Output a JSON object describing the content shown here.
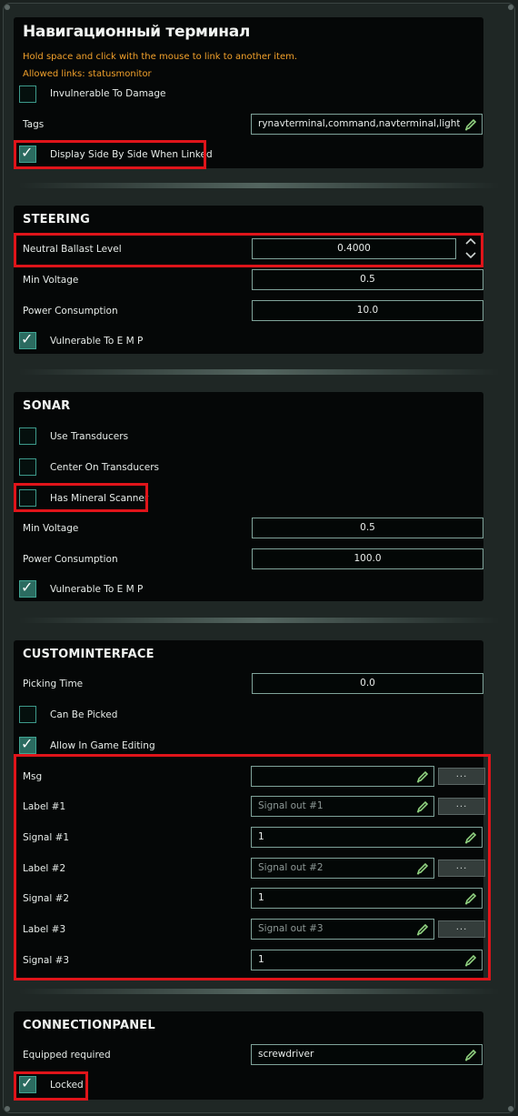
{
  "window": {
    "title": "Навигационный терминал",
    "hint": "Hold space and click with the mouse to link to another item.",
    "allowed_links": "Allowed links: statusmonitor"
  },
  "general": {
    "invulnerable_label": "Invulnerable To Damage",
    "invulnerable_checked": false,
    "tags_label": "Tags",
    "tags_value": "rynavterminal,command,navterminal,light",
    "side_by_side_label": "Display Side By Side When Linked",
    "side_by_side_checked": true
  },
  "steering": {
    "title": "STEERING",
    "ballast_label": "Neutral Ballast Level",
    "ballast_value": "0.4000",
    "min_voltage_label": "Min Voltage",
    "min_voltage_value": "0.5",
    "power_label": "Power Consumption",
    "power_value": "10.0",
    "emp_label": "Vulnerable To E M P",
    "emp_checked": true
  },
  "sonar": {
    "title": "SONAR",
    "use_transducers_label": "Use Transducers",
    "use_transducers_checked": false,
    "center_transducers_label": "Center On Transducers",
    "center_transducers_checked": false,
    "mineral_label": "Has Mineral Scanner",
    "mineral_checked": false,
    "min_voltage_label": "Min Voltage",
    "min_voltage_value": "0.5",
    "power_label": "Power Consumption",
    "power_value": "100.0",
    "emp_label": "Vulnerable To E M P",
    "emp_checked": true
  },
  "custominterface": {
    "title": "CUSTOMINTERFACE",
    "picking_time_label": "Picking Time",
    "picking_time_value": "0.0",
    "can_be_picked_label": "Can Be Picked",
    "can_be_picked_checked": false,
    "allow_editing_label": "Allow In Game Editing",
    "allow_editing_checked": true,
    "msg_label": "Msg",
    "msg_value": "",
    "label1_label": "Label #1",
    "label1_placeholder": "Signal out #1",
    "signal1_label": "Signal #1",
    "signal1_value": "1",
    "label2_label": "Label #2",
    "label2_placeholder": "Signal out #2",
    "signal2_label": "Signal #2",
    "signal2_value": "1",
    "label3_label": "Label #3",
    "label3_placeholder": "Signal out #3",
    "signal3_label": "Signal #3",
    "signal3_value": "1",
    "more_button": "..."
  },
  "connectionpanel": {
    "title": "CONNECTIONPANEL",
    "equipped_label": "Equipped required",
    "equipped_value": "screwdriver",
    "locked_label": "Locked",
    "locked_checked": true
  },
  "colors": {
    "highlight": "#e0141a",
    "accent_teal": "#3fa492",
    "hint_orange": "#f2a12b"
  },
  "icons": [
    "pencil-icon",
    "chevron-up-icon",
    "chevron-down-icon",
    "checkmark-icon"
  ]
}
